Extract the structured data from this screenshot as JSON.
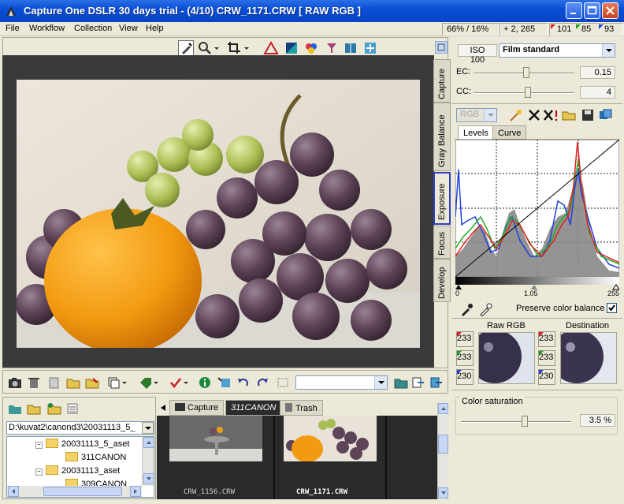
{
  "window": {
    "title": "Capture One DSLR 30 days trial  -  (4/10) CRW_1171.CRW  [ RAW RGB ]"
  },
  "menu": {
    "items": [
      "File",
      "Workflow",
      "Collection",
      "View",
      "Help"
    ]
  },
  "status": {
    "zoom": "66% / 16%",
    "coords": "+   2, 265",
    "r": "101",
    "g": "85",
    "b": "93"
  },
  "colors": {
    "accent": "#0a4fd6",
    "active_tab_border": "#3040c0",
    "hist_red": "#e02020",
    "hist_green": "#20b020",
    "hist_blue": "#2040e0"
  },
  "side_tabs": [
    "Capture",
    "Gray Balance",
    "Exposure",
    "Focus",
    "Develop"
  ],
  "right": {
    "iso": "ISO 100",
    "profile": "Film standard",
    "ec_label": "EC:",
    "ec_value": "0.15",
    "cc_label": "CC:",
    "cc_value": "4",
    "mode": "RGB",
    "hist_tabs": [
      "Levels",
      "Curve"
    ],
    "scale": [
      "0",
      "1.05",
      "255"
    ],
    "preserve_label": "Preserve color balance",
    "preserve_checked": true,
    "raw_rgb_label": "Raw RGB",
    "destination_label": "Destination",
    "raw_values": [
      "233",
      "233",
      "230"
    ],
    "dest_values": [
      "233",
      "233",
      "230"
    ],
    "saturation_label": "Color saturation",
    "saturation_value": "3.5 %"
  },
  "browser": {
    "path": "D:\\kuvat2\\canond3\\20031113_5_",
    "tree": [
      {
        "label": "20031113_5_aset",
        "expanded": true
      },
      {
        "label": "311CANON"
      },
      {
        "label": "20031113_aset",
        "expanded": true
      },
      {
        "label": "309CANON"
      }
    ]
  },
  "filmstrip": {
    "tabs": [
      "Capture",
      "311CANON",
      "Trash"
    ],
    "thumbs": [
      "CRW_1156.CRW",
      "CRW_1171.CRW"
    ]
  }
}
